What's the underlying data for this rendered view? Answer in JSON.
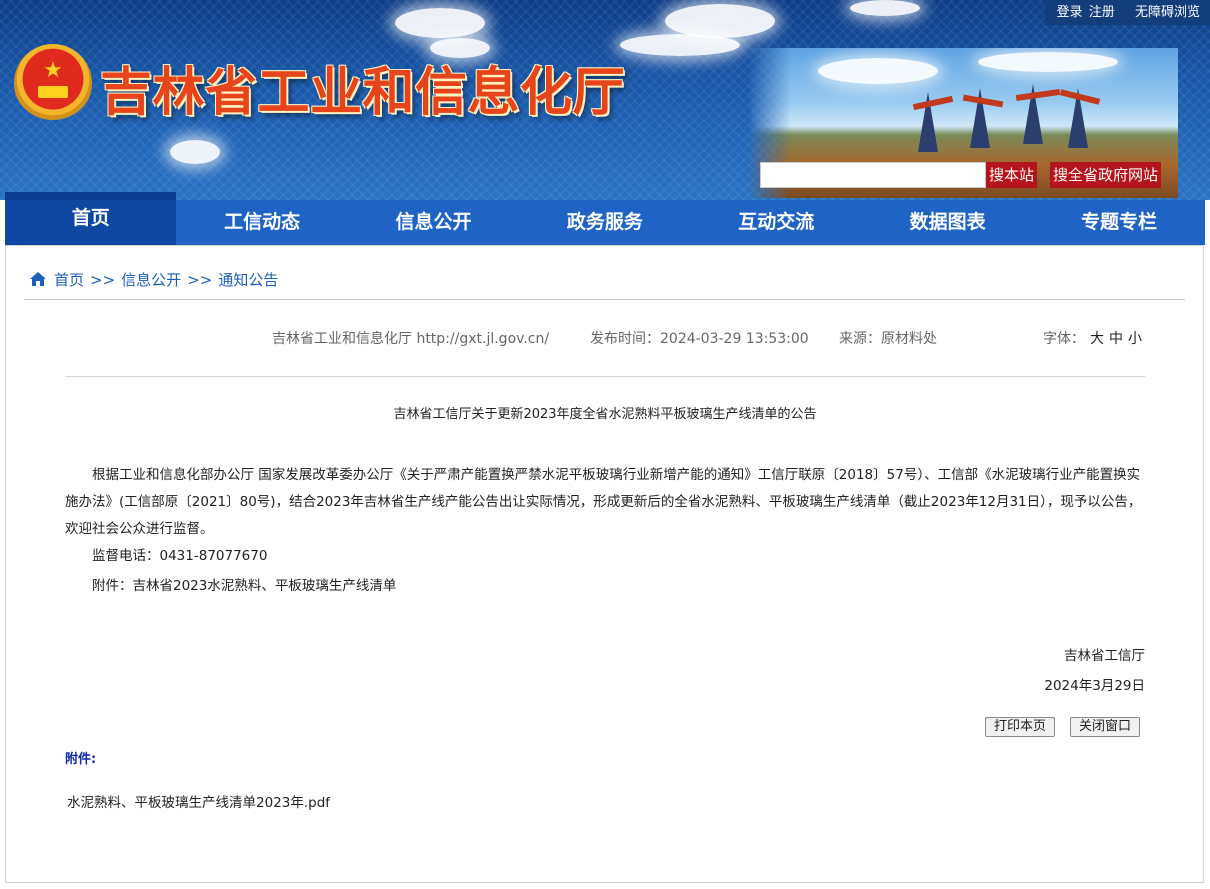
{
  "header": {
    "site_title": "吉林省工业和信息化厅",
    "top_links": {
      "login": "登录",
      "register": "注册",
      "accessibility": "无障碍浏览"
    },
    "search": {
      "placeholder": "",
      "btn_site": "搜本站",
      "btn_province": "搜全省政府网站"
    }
  },
  "nav": {
    "items": [
      "首页",
      "工信动态",
      "信息公开",
      "政务服务",
      "互动交流",
      "数据图表",
      "专题专栏"
    ],
    "active_index": 0
  },
  "breadcrumb": {
    "home": "首页",
    "sep": ">>",
    "level1": "信息公开",
    "level2": "通知公告"
  },
  "meta": {
    "site": "吉林省工业和信息化厅 http://gxt.jl.gov.cn/",
    "publish_label": "发布时间：",
    "publish_time": "2024-03-29 13:53:00",
    "source_label": "来源：",
    "source": "原材料处",
    "font_label": "字体：",
    "font_large": "大",
    "font_medium": "中",
    "font_small": "小"
  },
  "article": {
    "title": "吉林省工信厅关于更新2023年度全省水泥熟料平板玻璃生产线清单的公告",
    "para1": "根据工业和信息化部办公厅 国家发展改革委办公厅《关于严肃产能置换严禁水泥平板玻璃行业新增产能的通知》工信厅联原〔2018〕57号）、工信部《水泥玻璃行业产能置换实施办法》(工信部原〔2021〕80号)，结合2023年吉林省生产线产能公告出让实际情况，形成更新后的全省水泥熟料、平板玻璃生产线清单（截止2023年12月31日），现予以公告，欢迎社会公众进行监督。",
    "phone": "监督电话：0431-87077670",
    "attachment_note": "附件：吉林省2023水泥熟料、平板玻璃生产线清单",
    "signature_org": "吉林省工信厅",
    "signature_date": "2024年3月29日"
  },
  "actions": {
    "print": "打印本页",
    "close": "关闭窗口"
  },
  "attachments": {
    "label": "附件:",
    "files": [
      "水泥熟料、平板玻璃生产线清单2023年.pdf"
    ]
  },
  "colors": {
    "nav_bg": "#1f63c4",
    "nav_active": "#0e48a3",
    "search_btn": "#b4141b",
    "link": "#1d5fb9",
    "attach_label": "#0c2aa6"
  }
}
